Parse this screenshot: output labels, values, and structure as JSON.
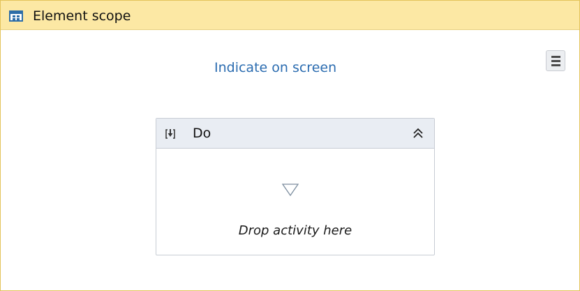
{
  "activity": {
    "title": "Element scope",
    "icon": "element-scope-icon",
    "header_color": "#fce8a4",
    "border_color": "#e3c35a"
  },
  "target": {
    "indicate_label": "Indicate on screen",
    "link_color": "#2b6cb0"
  },
  "menu": {
    "icon": "hamburger-menu-icon"
  },
  "do_block": {
    "title": "Do",
    "icon": "sequence-icon",
    "collapse_icon": "double-chevron-up-icon",
    "drop_icon": "drop-triangle-icon",
    "drop_text": "Drop activity here"
  }
}
